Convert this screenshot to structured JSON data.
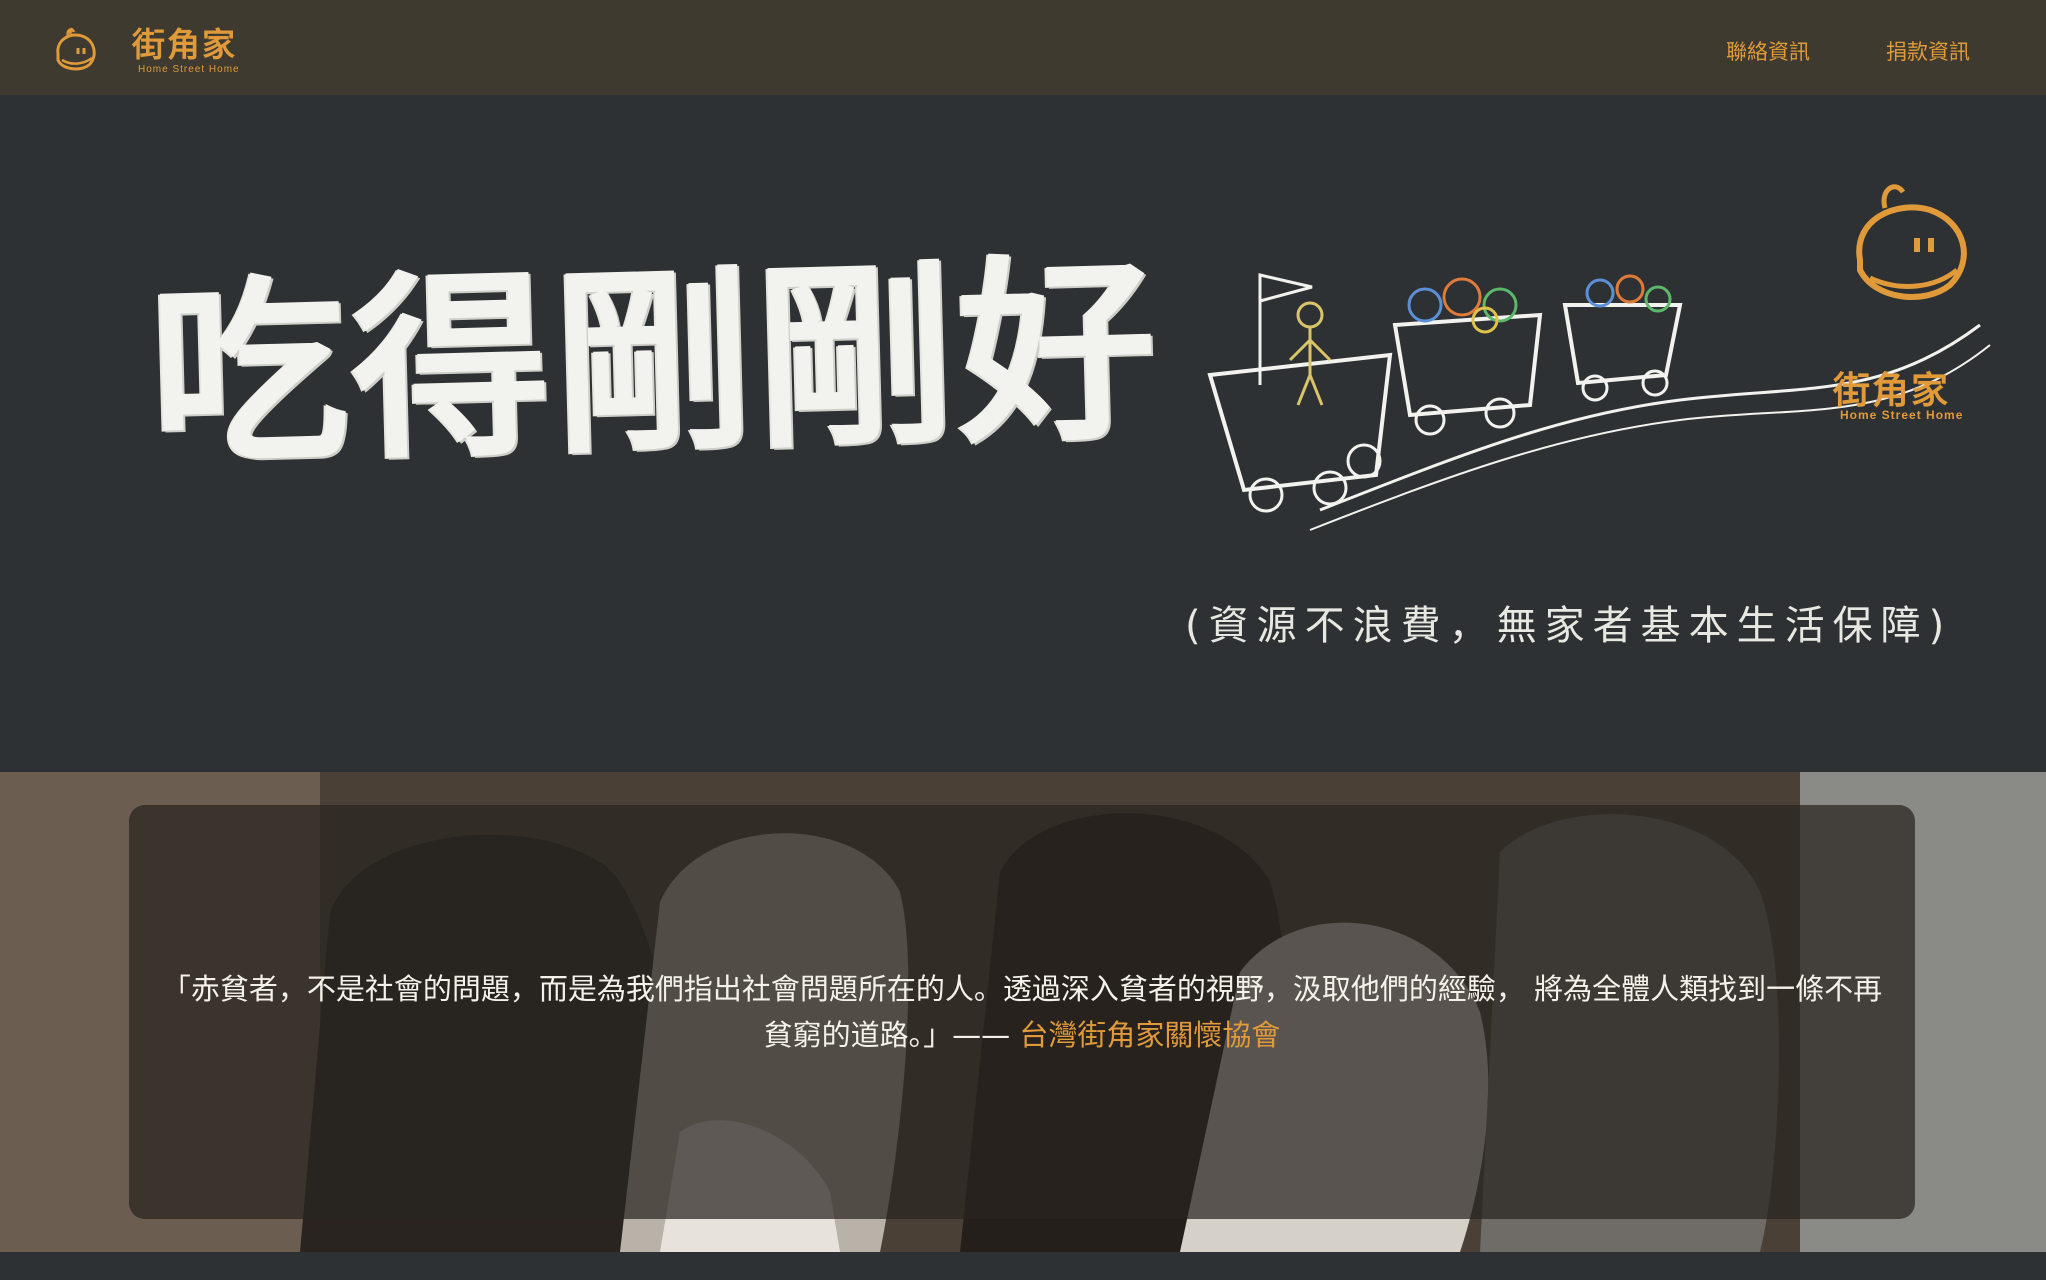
{
  "header": {
    "brand_name": "街角家",
    "brand_sub": "Home Street Home",
    "nav": [
      {
        "label": "聯絡資訊"
      },
      {
        "label": "捐款資訊"
      }
    ]
  },
  "hero": {
    "title": "吃得剛剛好",
    "subtitle": "(資源不浪費，無家者基本生活保障)",
    "logo_name": "街角家",
    "logo_sub": "Home Street Home"
  },
  "quote": {
    "text": "「赤貧者，不是社會的問題，而是為我們指出社會問題所在的人。透過深入貧者的視野，汲取他們的經驗， 將為全體人類找到一條不再貧窮的道路。」—— ",
    "attribution": "台灣街角家關懷協會"
  },
  "colors": {
    "accent": "#e09a3a",
    "header_bg": "#3e3a30",
    "page_bg": "#2e3133"
  }
}
